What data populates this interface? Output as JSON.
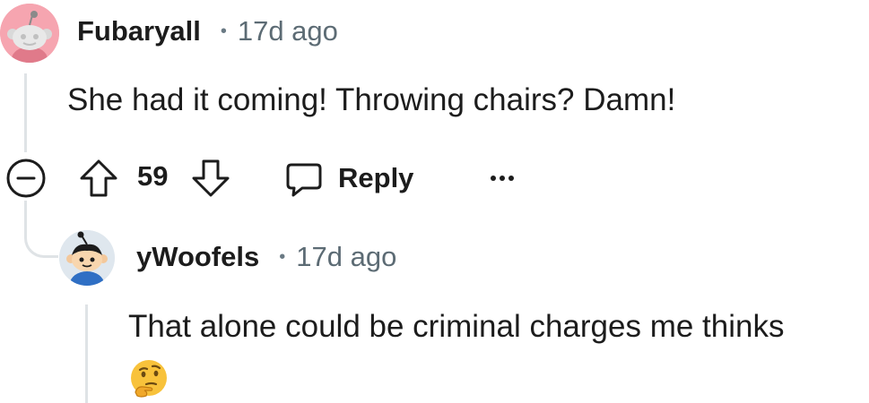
{
  "comment": {
    "username": "Fubaryall",
    "separator": "•",
    "time_ago": "17d ago",
    "body": "She had it coming! Throwing chairs? Damn!",
    "avatar_icon": "snoo-avatar-pink",
    "vote_count": "59",
    "actions": {
      "collapse_icon": "collapse-minus-icon",
      "upvote_icon": "arrow-up-icon",
      "downvote_icon": "arrow-down-icon",
      "reply_icon": "chat-bubble-icon",
      "reply_label": "Reply",
      "more_icon": "ellipsis-icon"
    }
  },
  "reply": {
    "username": "yWoofels",
    "separator": "•",
    "time_ago": "17d ago",
    "body": "That alone could be criminal charges me thinks",
    "emoji_icon": "thinking-face-icon",
    "avatar_icon": "snoo-avatar-blue"
  },
  "colors": {
    "text": "#1c1c1c",
    "meta": "#5c6b74",
    "thread_line": "#dfe3e6",
    "avatar_top_bg": "#f6a5b0",
    "avatar_reply_bg": "#dfe7ee"
  }
}
